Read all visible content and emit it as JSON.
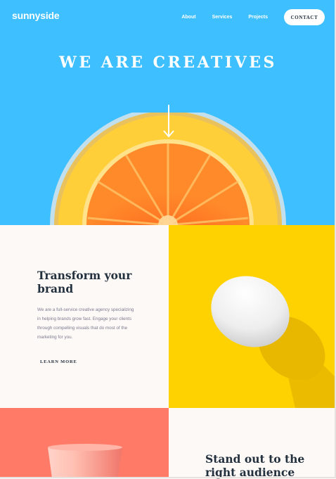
{
  "header": {
    "logo": "sunnyside",
    "nav": [
      {
        "label": "About"
      },
      {
        "label": "Services"
      },
      {
        "label": "Projects"
      }
    ],
    "contact_label": "CONTACT"
  },
  "hero": {
    "headline": "WE ARE CREATIVES"
  },
  "transform": {
    "title": "Transform your brand",
    "body": "We are a full-service creative agency specializing in helping brands grow fast. Engage your clients through compelling visuals that do most of the marketing for you.",
    "link_label": "LEARN MORE"
  },
  "standout": {
    "title": "Stand out to the right audience"
  },
  "colors": {
    "hero_bg": "#3ebfff",
    "egg_bg": "#fed200",
    "cup_bg": "#ff7b67",
    "text_dark": "#23303e",
    "body_text": "#7b7a90",
    "link_highlight": "#fbd37a"
  },
  "icons": [
    "arrow-down-icon"
  ]
}
